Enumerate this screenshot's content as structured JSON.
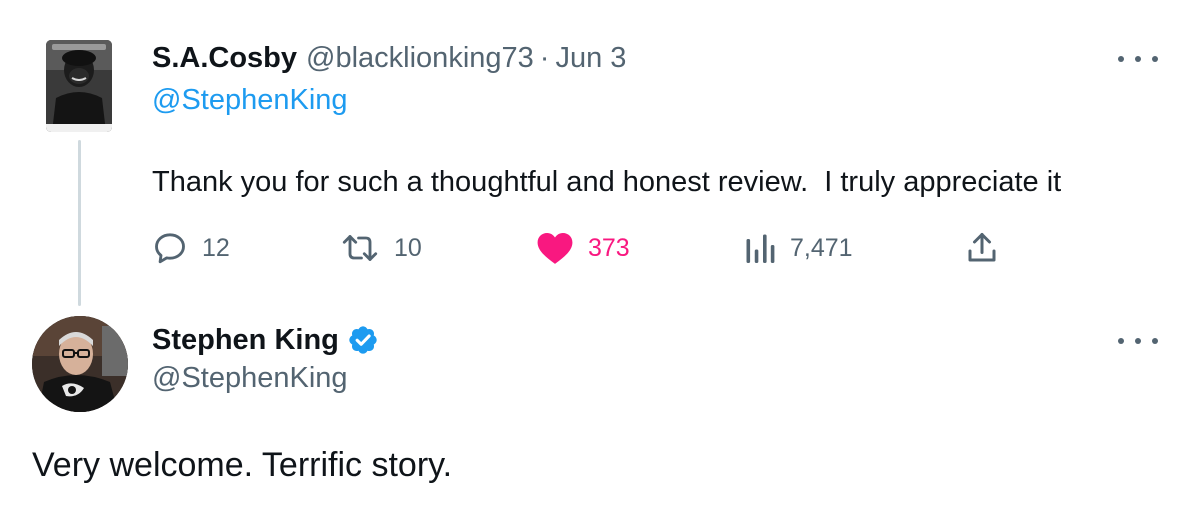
{
  "reply_tweet": {
    "author": {
      "display_name": "S.A.Cosby",
      "handle": "@blacklionking73",
      "separator": "·",
      "date": "Jun 3"
    },
    "replying_to": "@StephenKing",
    "text": "Thank you for such a thoughtful and honest review.  I truly appreciate it",
    "actions": {
      "replies": {
        "icon": "reply-icon",
        "count": "12"
      },
      "retweets": {
        "icon": "retweet-icon",
        "count": "10"
      },
      "likes": {
        "icon": "heart-filled-icon",
        "count": "373",
        "liked": true
      },
      "views": {
        "icon": "views-icon",
        "count": "7,471"
      },
      "share": {
        "icon": "share-icon"
      }
    },
    "more_icon": "more-horizontal-icon"
  },
  "main_tweet": {
    "author": {
      "display_name": "Stephen King",
      "verified": true,
      "handle": "@StephenKing"
    },
    "text": "Very welcome. Terrific story.",
    "more_icon": "more-horizontal-icon"
  },
  "colors": {
    "text_primary": "#0f1419",
    "text_secondary": "#536471",
    "link": "#1d9bf0",
    "like": "#f91880",
    "verified": "#1d9bf0",
    "thread_line": "#cfd9de"
  }
}
